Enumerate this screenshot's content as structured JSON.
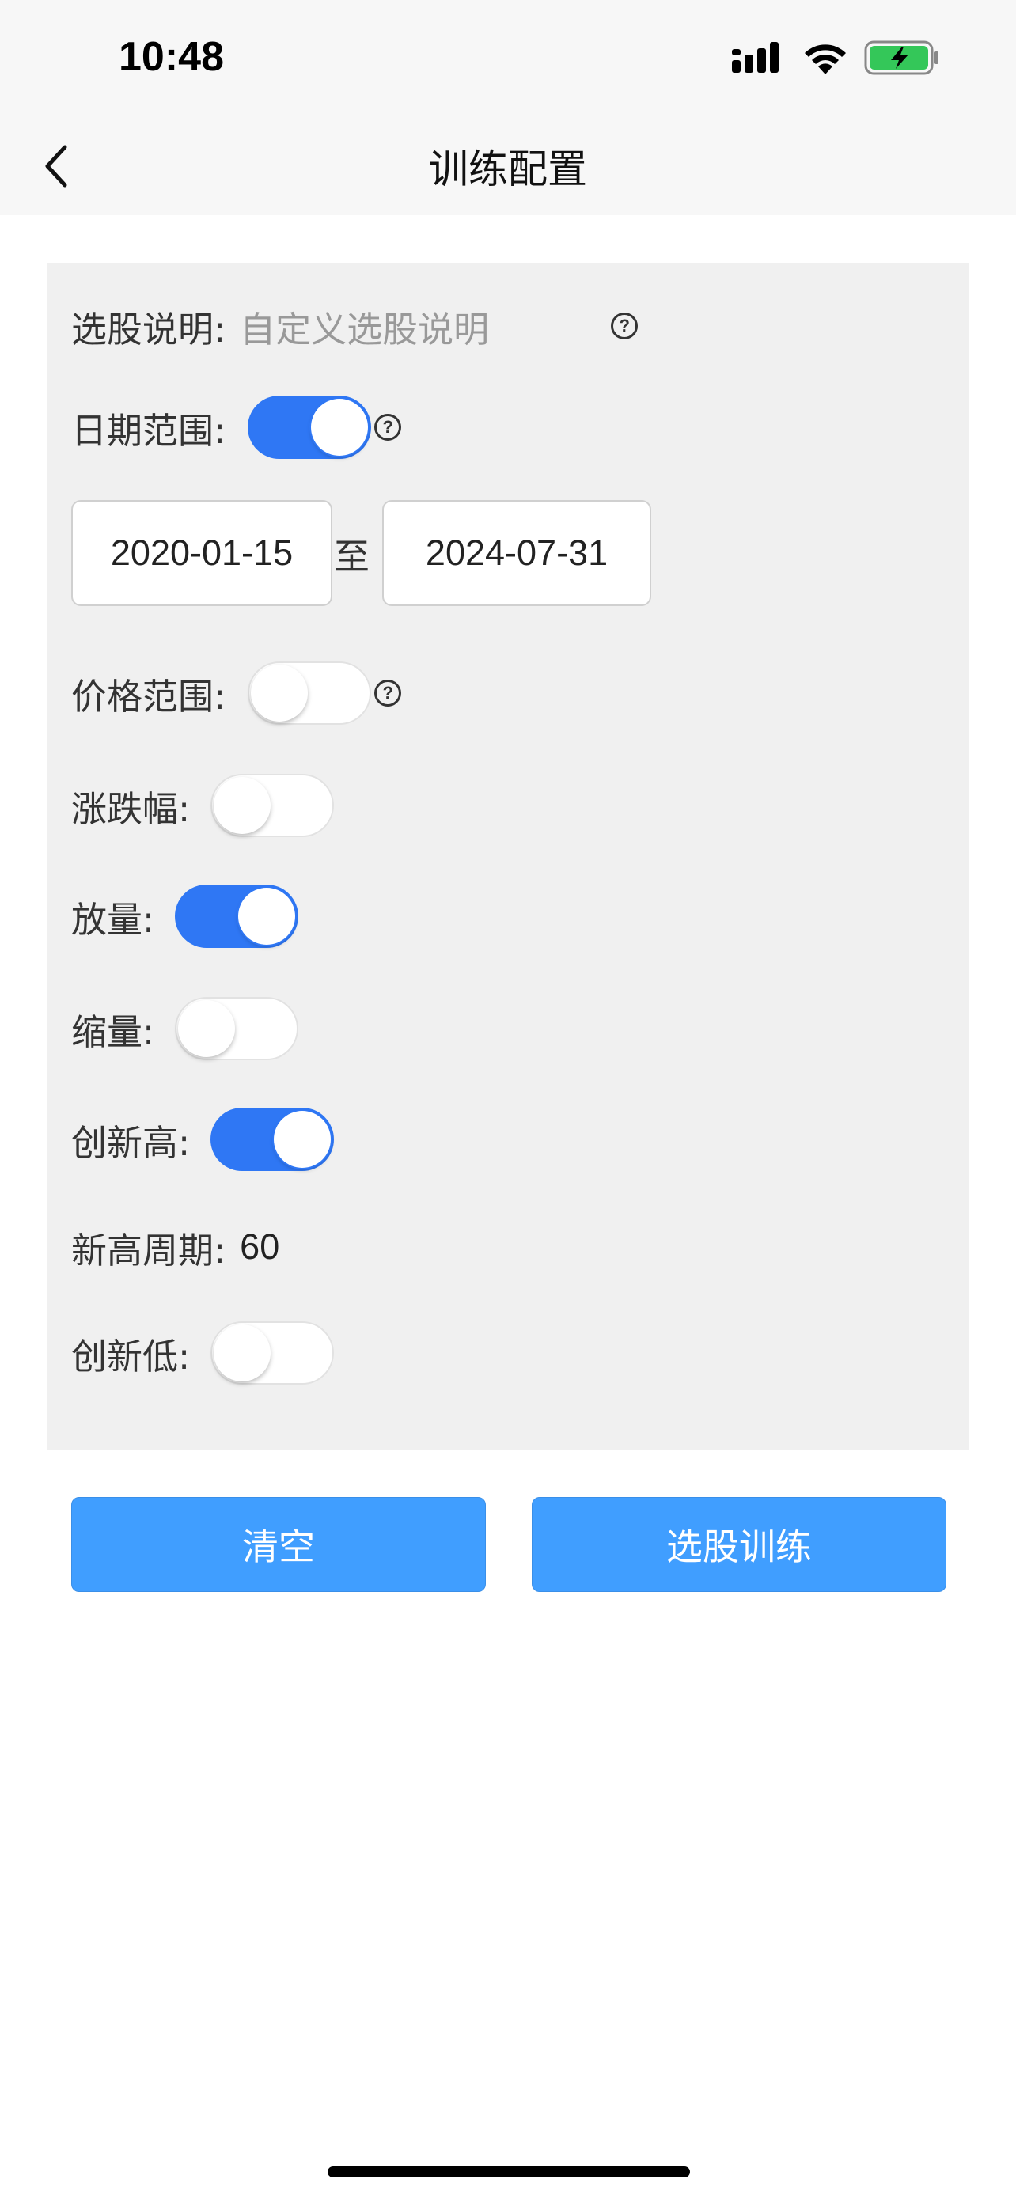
{
  "status_bar": {
    "time": "10:48",
    "icons": [
      "signal-icon",
      "wifi-icon",
      "battery-charging-icon"
    ],
    "battery_color": "#34c759"
  },
  "nav": {
    "title": "训练配置",
    "back_icon": "chevron-left-icon"
  },
  "form": {
    "description": {
      "label": "选股说明:",
      "placeholder": "自定义选股说明"
    },
    "date_range": {
      "label": "日期范围:",
      "enabled": true,
      "start": "2020-01-15",
      "separator": "至",
      "end": "2024-07-31"
    },
    "price_range": {
      "label": "价格范围:",
      "enabled": false
    },
    "change_pct": {
      "label": "涨跌幅:",
      "enabled": false
    },
    "volume_up": {
      "label": "放量:",
      "enabled": true
    },
    "volume_down": {
      "label": "缩量:",
      "enabled": false
    },
    "new_high": {
      "label": "创新高:",
      "enabled": true
    },
    "new_high_period": {
      "label": "新高周期:",
      "value": "60"
    },
    "new_low": {
      "label": "创新低:",
      "enabled": false
    },
    "help_glyph": "?"
  },
  "actions": {
    "clear_label": "清空",
    "train_label": "选股训练"
  },
  "colors": {
    "accent": "#2f77f4",
    "button": "#409eff",
    "panel_bg": "#f0f0f0"
  }
}
